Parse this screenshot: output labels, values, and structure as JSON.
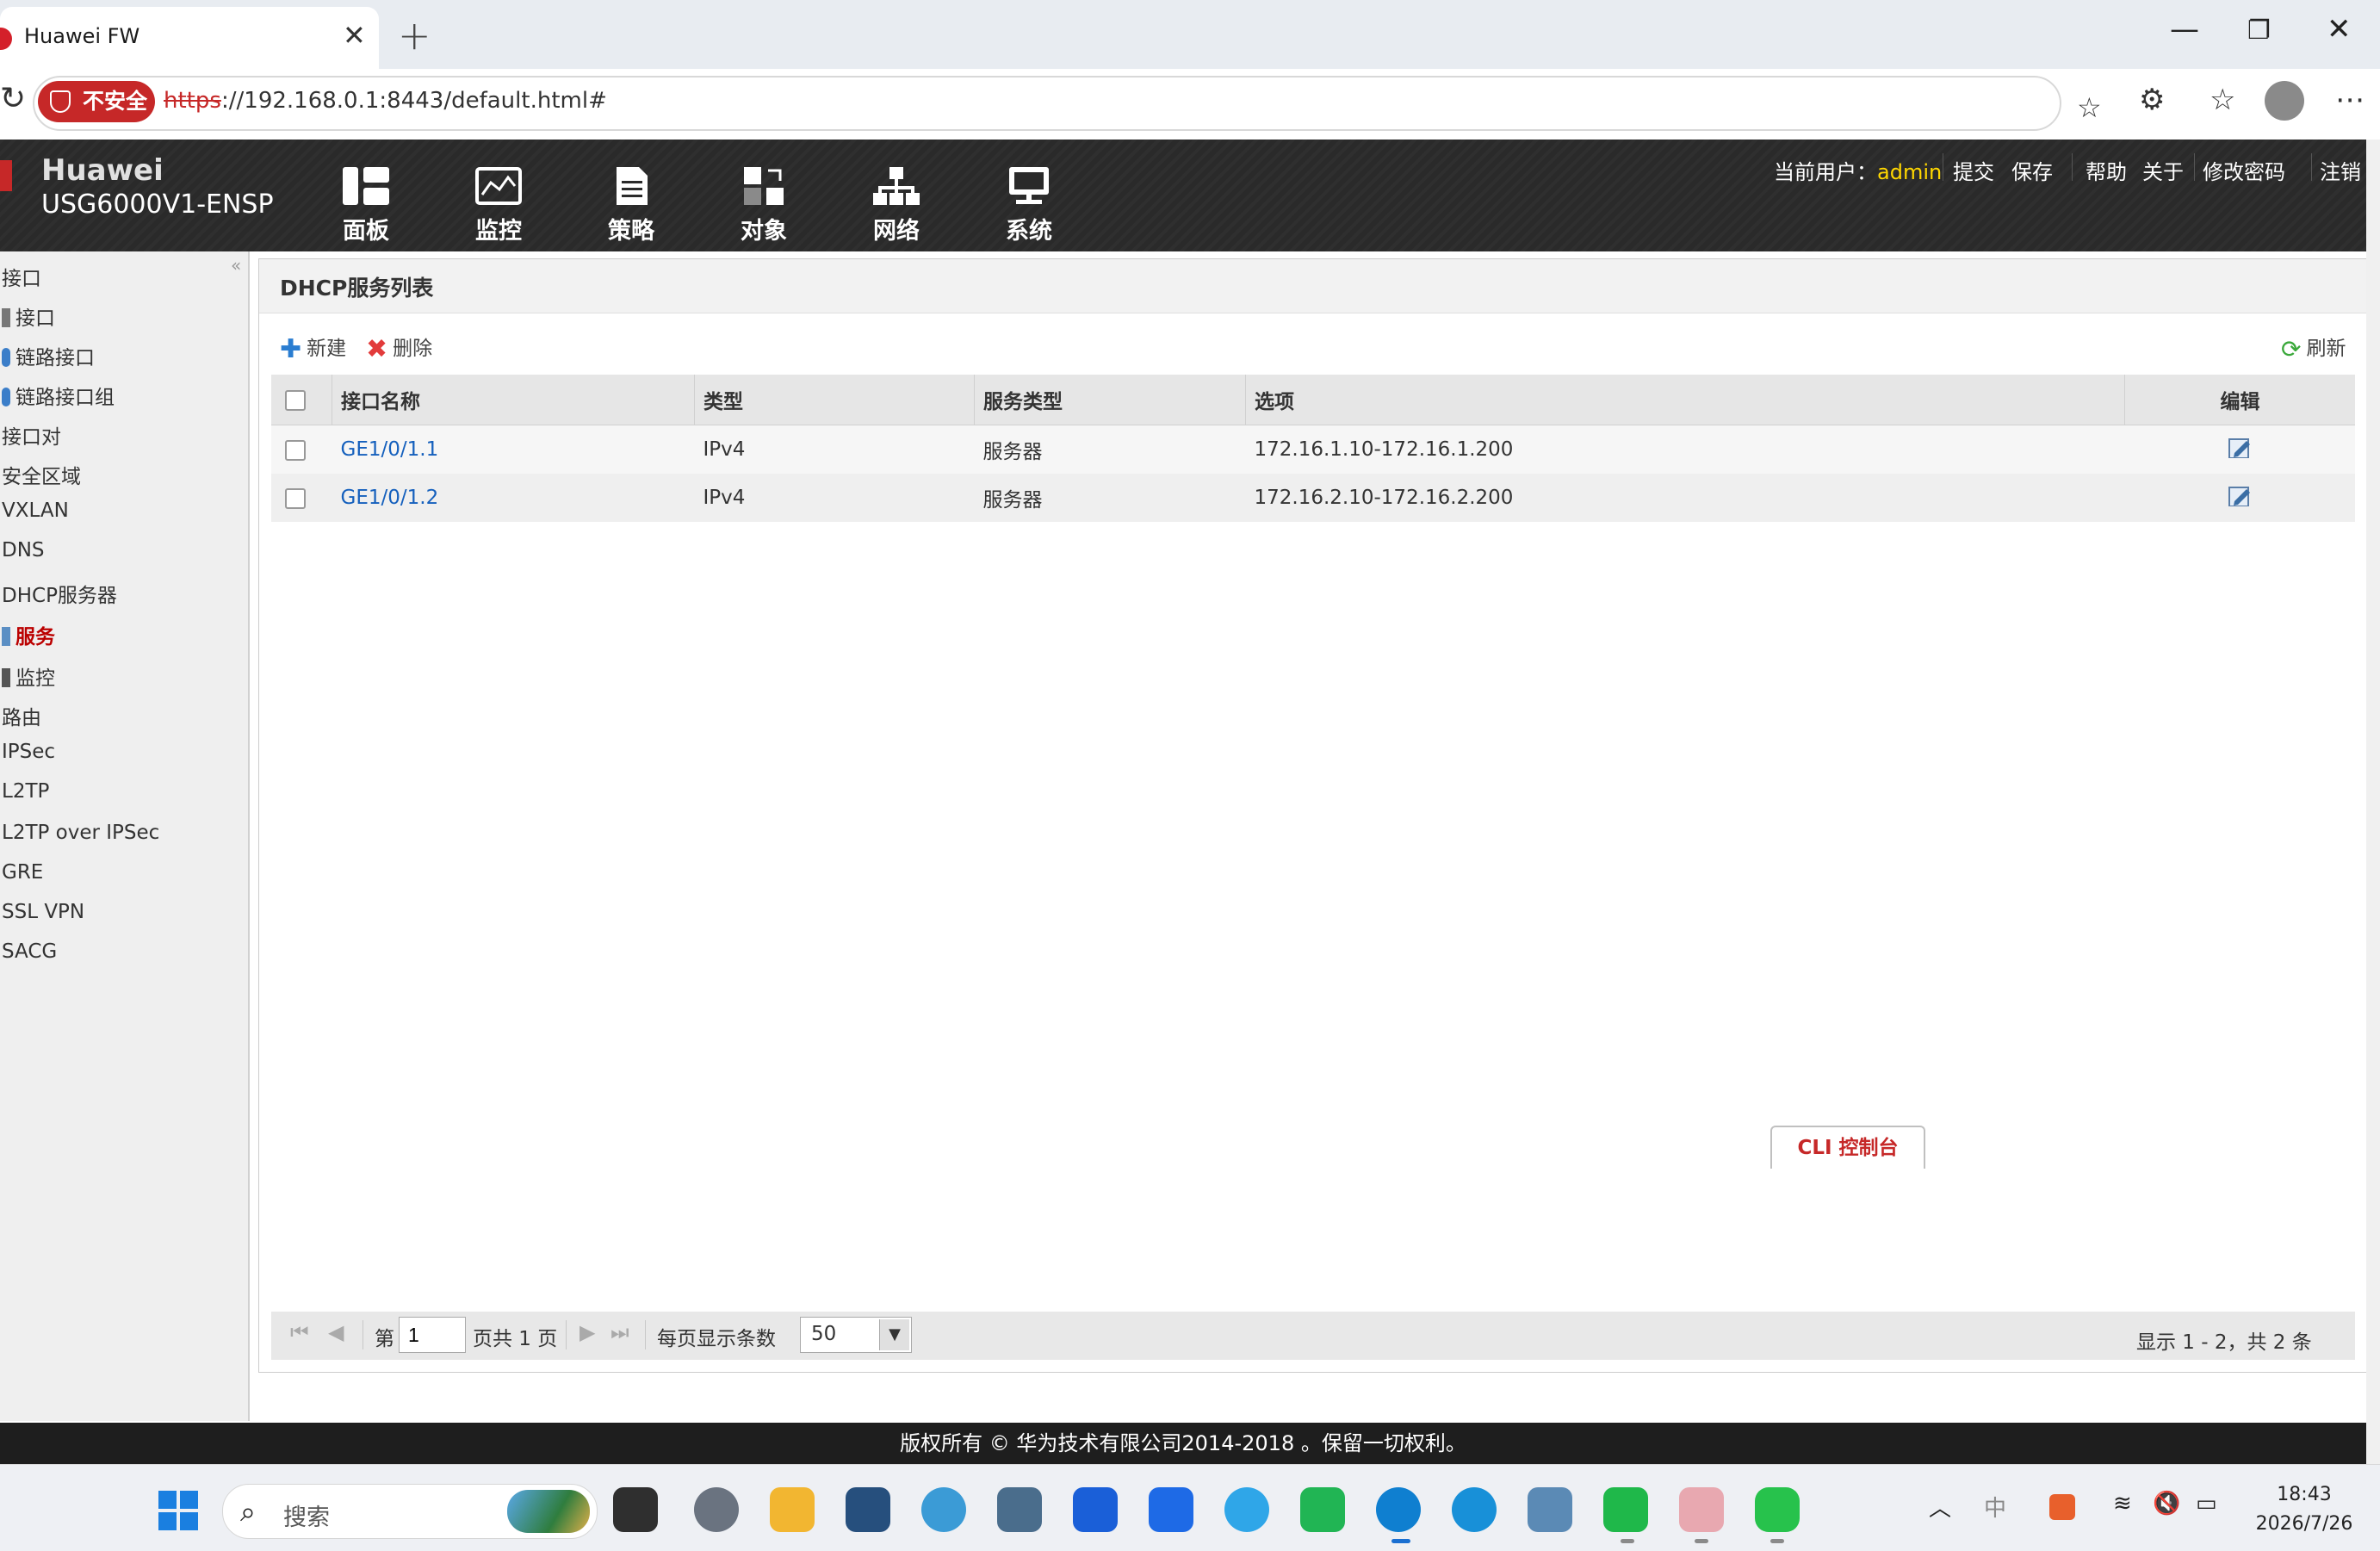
{
  "browser": {
    "tab_title": "Huawei FW",
    "close_tab": "✕",
    "new_tab": "+",
    "window_controls": {
      "minimize": "—",
      "maximize": "❐",
      "close": "✕"
    },
    "security_label": "不安全",
    "url_scheme": "https",
    "url_rest": "://192.168.0.1:8443/default.html#"
  },
  "app": {
    "brand_name": "Huawei",
    "model": "USG6000V1-ENSP",
    "nav": [
      {
        "label": "面板",
        "icon": "dashboard-icon"
      },
      {
        "label": "监控",
        "icon": "monitor-icon"
      },
      {
        "label": "策略",
        "icon": "policy-icon"
      },
      {
        "label": "对象",
        "icon": "object-icon"
      },
      {
        "label": "网络",
        "icon": "network-icon",
        "active": true
      },
      {
        "label": "系统",
        "icon": "system-icon"
      }
    ],
    "user_prefix": "当前用户：",
    "user_name": "admin",
    "user_links": [
      "提交",
      "保存",
      "帮助",
      "关于",
      "修改密码",
      "注销"
    ]
  },
  "sidebar": {
    "items": [
      {
        "label": "接口",
        "icon": "none"
      },
      {
        "label": "接口",
        "icon": "interface-icon"
      },
      {
        "label": "链路接口",
        "icon": "link-interface-icon"
      },
      {
        "label": "链路接口组",
        "icon": "link-group-icon"
      },
      {
        "label": "接口对",
        "icon": "none"
      },
      {
        "label": "安全区域",
        "icon": "none"
      },
      {
        "label": "VXLAN",
        "icon": "none"
      },
      {
        "label": "DNS",
        "icon": "none"
      },
      {
        "label": "DHCP服务器",
        "icon": "none"
      },
      {
        "label": "服务",
        "icon": "service-icon",
        "active": true
      },
      {
        "label": "监控",
        "icon": "monitor-small-icon"
      },
      {
        "label": "路由",
        "icon": "none"
      },
      {
        "label": "IPSec",
        "icon": "none"
      },
      {
        "label": "L2TP",
        "icon": "none"
      },
      {
        "label": "L2TP over IPSec",
        "icon": "none"
      },
      {
        "label": "GRE",
        "icon": "none"
      },
      {
        "label": "SSL VPN",
        "icon": "none"
      },
      {
        "label": "SACG",
        "icon": "none"
      }
    ]
  },
  "main": {
    "panel_title": "DHCP服务列表",
    "toolbar": {
      "new_label": "新建",
      "delete_label": "删除",
      "refresh_label": "刷新"
    },
    "table": {
      "columns": [
        "接口名称",
        "类型",
        "服务类型",
        "选项",
        "编辑"
      ],
      "rows": [
        {
          "interface": "GE1/0/1.1",
          "type": "IPv4",
          "service_type": "服务器",
          "options": "172.16.1.10-172.16.1.200"
        },
        {
          "interface": "GE1/0/1.2",
          "type": "IPv4",
          "service_type": "服务器",
          "options": "172.16.2.10-172.16.2.200"
        }
      ]
    },
    "pager": {
      "page_prefix": "第",
      "page_value": "1",
      "page_suffix": "页共 1 页",
      "per_page_label": "每页显示条数",
      "per_page_value": "50",
      "summary": "显示 1 - 2，共 2 条"
    },
    "cli_label": "CLI 控制台"
  },
  "footer": {
    "copyright": "版权所有 © 华为技术有限公司2014-2018 。保留一切权利。"
  },
  "taskbar": {
    "search_placeholder": "搜索",
    "time": "18:43",
    "date": "2026/7/26",
    "ime": "中"
  }
}
